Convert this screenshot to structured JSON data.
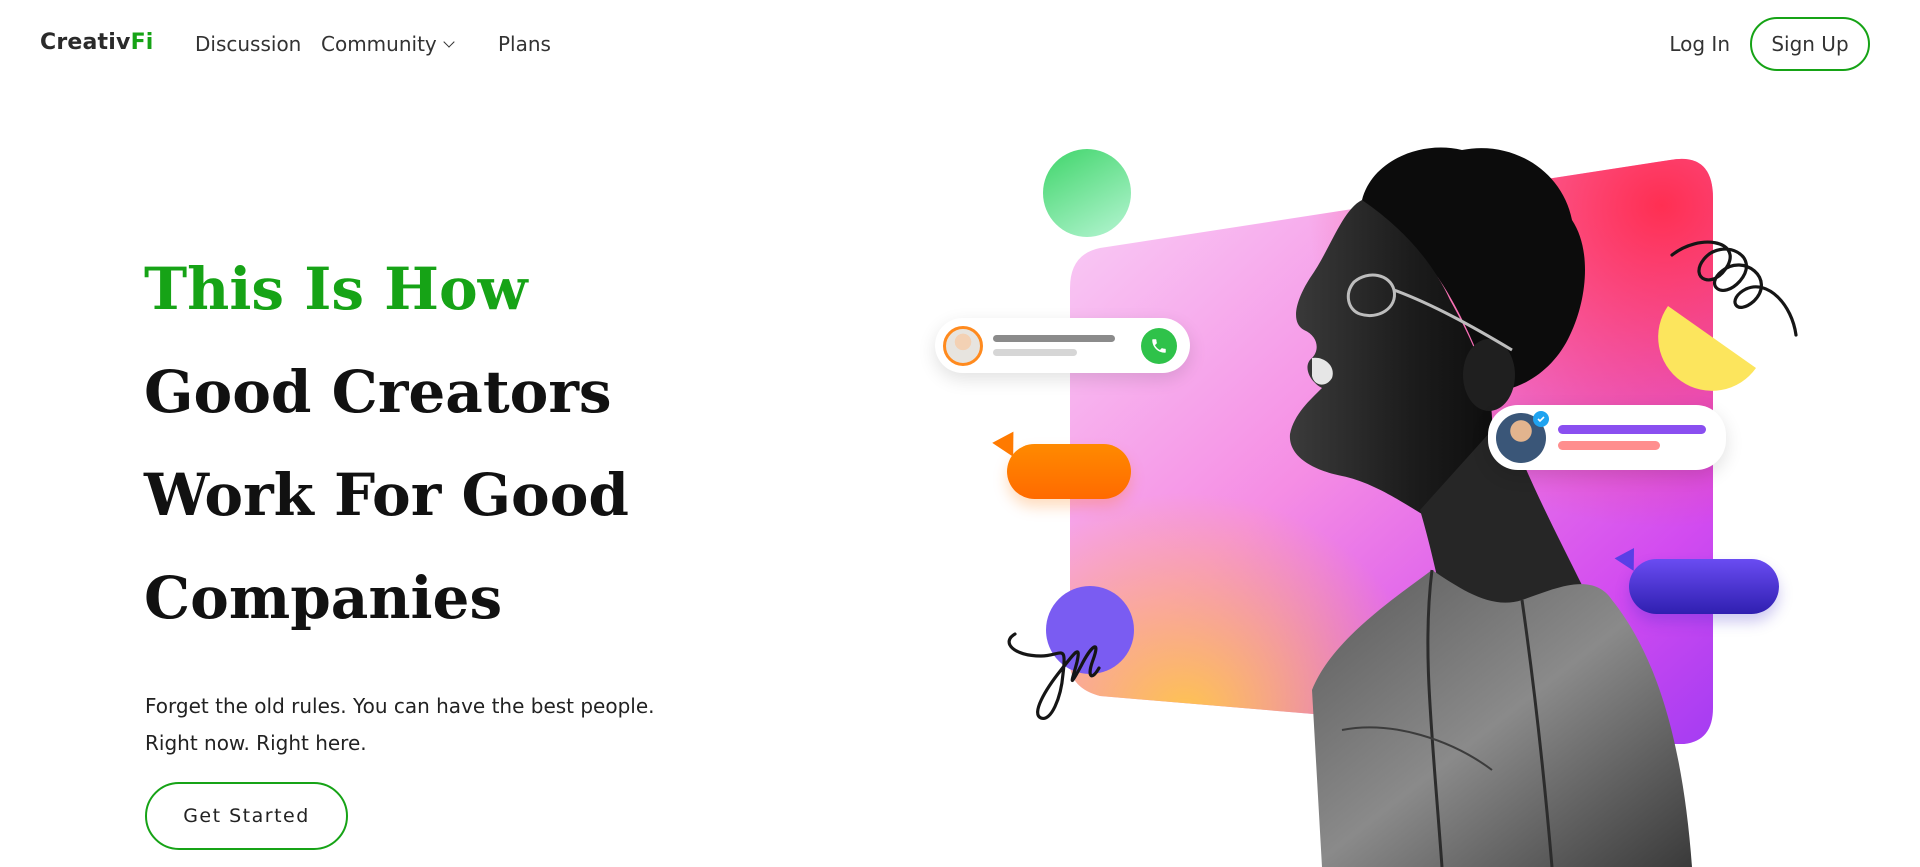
{
  "nav": {
    "logo_main": "Creativ",
    "logo_accent": "Fi",
    "links": [
      {
        "label": "Discussion"
      },
      {
        "label": "Community"
      },
      {
        "label": "Plans"
      }
    ],
    "login_label": "Log In",
    "signup_label": "Sign Up"
  },
  "hero": {
    "title_lines": [
      "This Is How",
      "Good Creators",
      "Work For Good",
      "Companies"
    ],
    "subtitle_lines": [
      "Forget the old rules. You can have the best people.",
      "Right now. Right here."
    ],
    "cta_label": "Get Started"
  },
  "colors": {
    "accent": "#16a316",
    "panel_gradient": [
      "#f7c6f5",
      "#ff3a6a",
      "#b24bf3",
      "#ffc15e"
    ],
    "orange": "#ff7a00",
    "indigo": "#3a25c4",
    "yellow": "#fce55d",
    "purple_circle": "#7a5cf2",
    "green_circle": "#3fd56a"
  },
  "icons": [
    "chevron-down-icon",
    "phone-icon",
    "verified-check-icon"
  ]
}
